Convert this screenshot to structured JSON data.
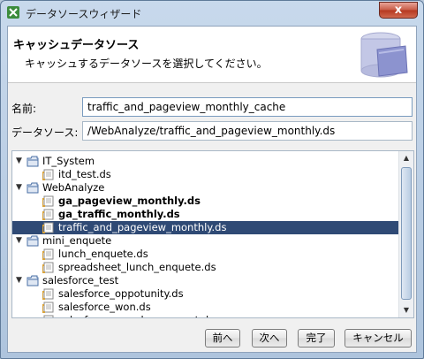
{
  "window": {
    "title": "データソースウィザード",
    "close_label": "x"
  },
  "header": {
    "title": "キャッシュデータソース",
    "subtitle": "キャッシュするデータソースを選択してください。",
    "graphic_icon": "database-folder-icon"
  },
  "form": {
    "name_label": "名前:",
    "name_value": "traffic_and_pageview_monthly_cache",
    "datasource_label": "データソース:",
    "datasource_value": "/WebAnalyze/traffic_and_pageview_monthly.ds"
  },
  "tree": {
    "rows": [
      {
        "label": "IT_System",
        "type": "folder",
        "expanded": true,
        "level": 0
      },
      {
        "label": "itd_test.ds",
        "type": "file",
        "level": 1
      },
      {
        "label": "WebAnalyze",
        "type": "folder",
        "expanded": true,
        "level": 0
      },
      {
        "label": "ga_pageview_monthly.ds",
        "type": "file",
        "level": 1,
        "bold": true
      },
      {
        "label": "ga_traffic_monthly.ds",
        "type": "file",
        "level": 1,
        "bold": true
      },
      {
        "label": "traffic_and_pageview_monthly.ds",
        "type": "file",
        "level": 1,
        "selected": true
      },
      {
        "label": "mini_enquete",
        "type": "folder",
        "expanded": true,
        "level": 0
      },
      {
        "label": "lunch_enquete.ds",
        "type": "file",
        "level": 1
      },
      {
        "label": "spreadsheet_lunch_enquete.ds",
        "type": "file",
        "level": 1
      },
      {
        "label": "salesforce_test",
        "type": "folder",
        "expanded": true,
        "level": 0
      },
      {
        "label": "salesforce_oppotunity.ds",
        "type": "file",
        "level": 1
      },
      {
        "label": "salesforce_won.ds",
        "type": "file",
        "level": 1
      },
      {
        "label": "salesforce_won_by_account.ds",
        "type": "file",
        "level": 1
      }
    ]
  },
  "buttons": {
    "back": "前へ",
    "next": "次へ",
    "finish": "完了",
    "cancel": "キャンセル"
  },
  "colors": {
    "selection": "#2f4a75",
    "folder": "#4a6fa5",
    "file": "#d9a33b"
  }
}
